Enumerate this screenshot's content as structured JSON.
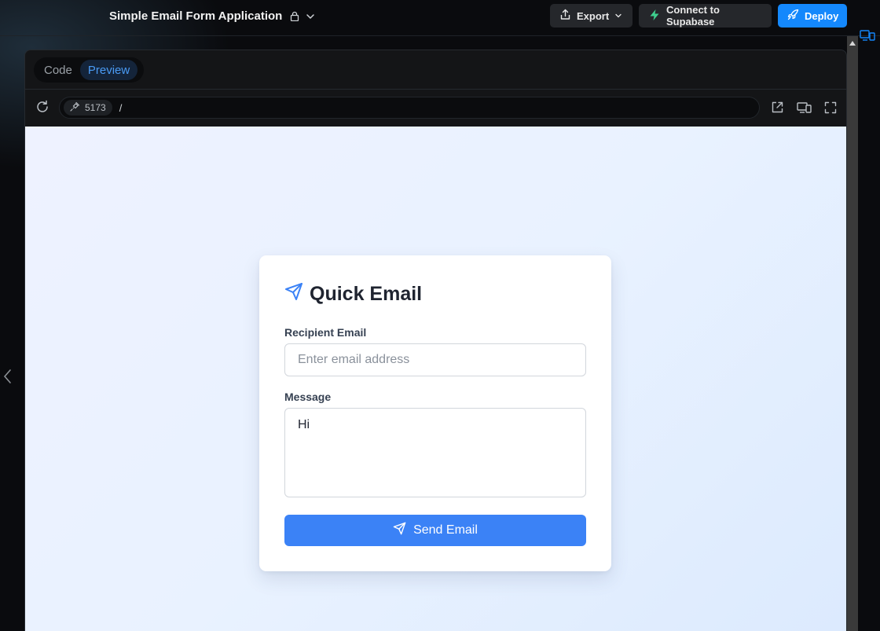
{
  "header": {
    "project_title": "Simple Email Form Application",
    "export_label": "Export",
    "supabase_label": "Connect to Supabase",
    "deploy_label": "Deploy"
  },
  "workbench": {
    "tabs": [
      {
        "label": "Code",
        "active": false
      },
      {
        "label": "Preview",
        "active": true
      }
    ],
    "url": {
      "port": "5173",
      "path": "/"
    }
  },
  "form": {
    "title": "Quick Email",
    "recipient_label": "Recipient Email",
    "recipient_placeholder": "Enter email address",
    "recipient_value": "",
    "message_label": "Message",
    "message_value": "Hi",
    "send_label": "Send Email"
  },
  "colors": {
    "accent": "#3b82f6",
    "deploy": "#1488fc",
    "supabase_green": "#3ecf8e"
  },
  "icons": {
    "title_lock": "lock-icon",
    "title_menu": "chevron-down-icon",
    "export": "share-icon",
    "supabase": "supabase-bolt-icon",
    "deploy": "rocket-icon",
    "reload": "reload-icon",
    "port": "plug-icon",
    "open_external": "external-link-icon",
    "device": "device-toggle-icon",
    "fullscreen": "fullscreen-icon",
    "form_title": "paper-plane-icon",
    "send": "paper-plane-icon"
  }
}
